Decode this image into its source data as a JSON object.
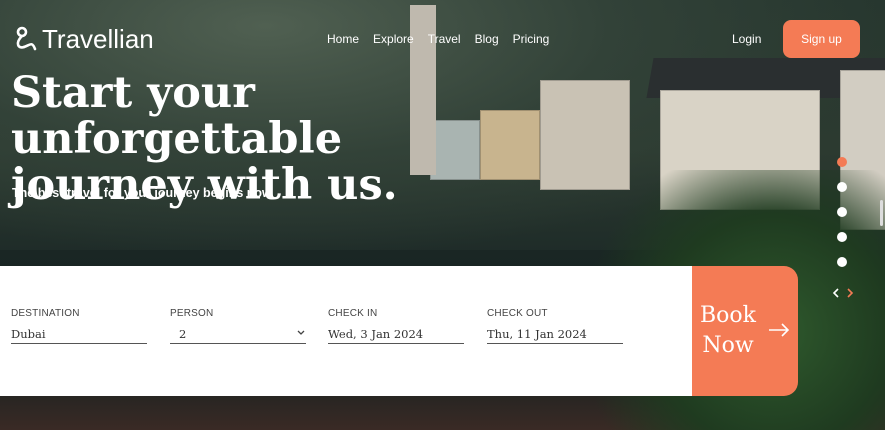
{
  "brand": {
    "name": "Travellian"
  },
  "nav": {
    "links": [
      "Home",
      "Explore",
      "Travel",
      "Blog",
      "Pricing"
    ],
    "login": "Login",
    "signup": "Sign up"
  },
  "hero": {
    "headline_line1": "Start your unforgettable",
    "headline_line2": "journey with us.",
    "subheadline": "The best travel for your journey begins now"
  },
  "booking": {
    "destination": {
      "label": "DESTINATION",
      "value": "Dubai"
    },
    "person": {
      "label": "PERSON",
      "value": "2"
    },
    "check_in": {
      "label": "CHECK IN",
      "value": "Wed, 3 Jan 2024"
    },
    "check_out": {
      "label": "CHECK OUT",
      "value": "Thu, 11 Jan 2024"
    },
    "button_line1": "Book",
    "button_line2": "Now"
  },
  "slider": {
    "count": 5,
    "active_index": 0
  },
  "colors": {
    "accent": "#f47b55",
    "text": "#ffffff"
  },
  "icons": {
    "logo": "person-route-icon",
    "chevron": "chevron-down-icon",
    "arrow": "arrow-right-icon",
    "prev": "chevron-left-icon",
    "next": "chevron-right-icon"
  }
}
